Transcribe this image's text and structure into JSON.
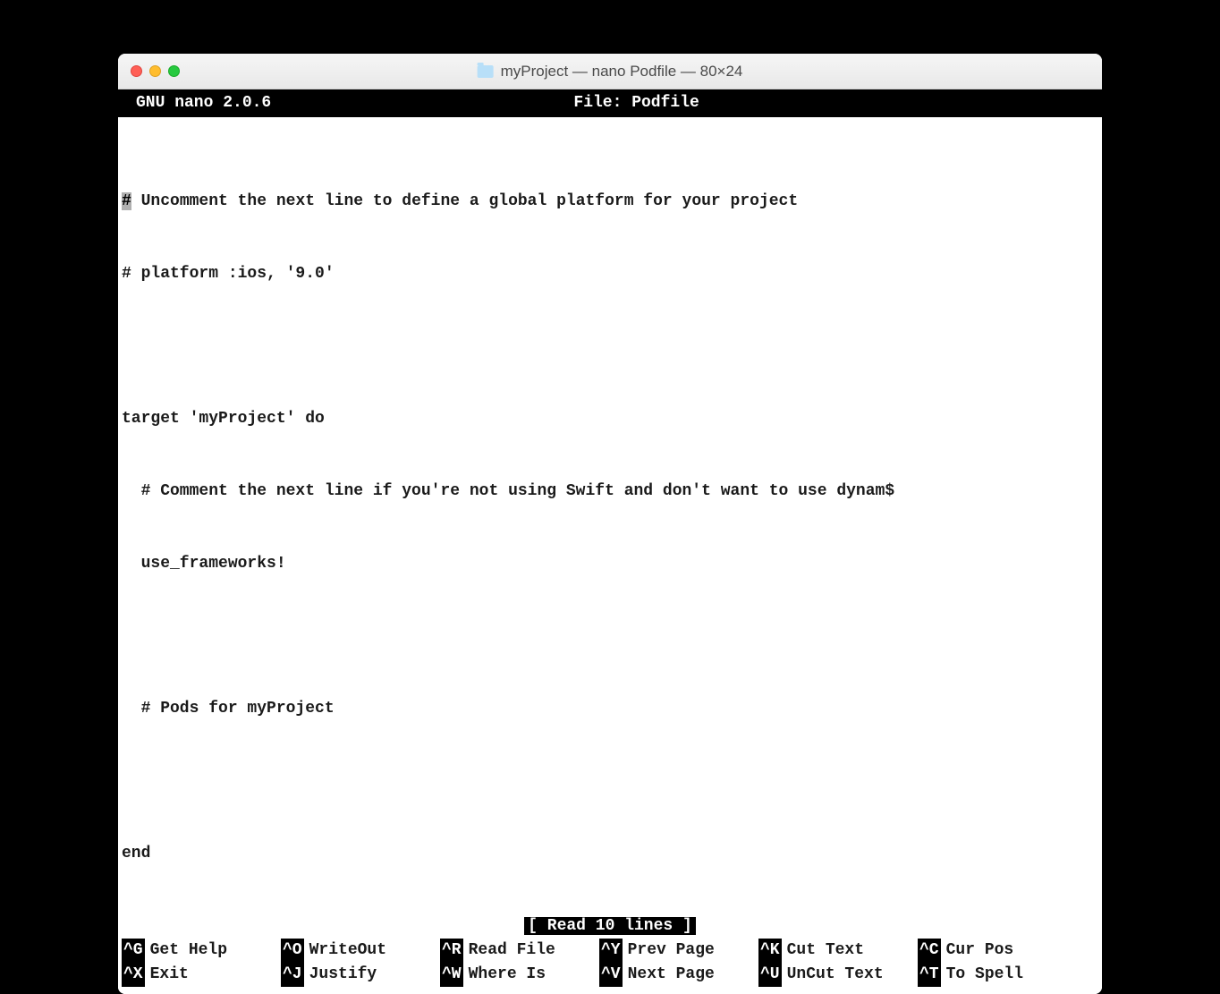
{
  "window": {
    "title": "myProject — nano Podfile — 80×24"
  },
  "header": {
    "app_name": "GNU nano 2.0.6",
    "file_label": "File: Podfile"
  },
  "editor": {
    "lines": [
      {
        "cursor_char": "#",
        "rest": " Uncomment the next line to define a global platform for your project"
      },
      {
        "text": "# platform :ios, '9.0'"
      },
      {
        "text": ""
      },
      {
        "text": "target 'myProject' do"
      },
      {
        "text": "  # Comment the next line if you're not using Swift and don't want to use dynam$"
      },
      {
        "text": "  use_frameworks!"
      },
      {
        "text": ""
      },
      {
        "text": "  # Pods for myProject"
      },
      {
        "text": ""
      },
      {
        "text": "end"
      }
    ]
  },
  "status": {
    "text": "[ Read 10 lines ]"
  },
  "shortcuts": {
    "row1": [
      {
        "key": "^G",
        "label": "Get Help"
      },
      {
        "key": "^O",
        "label": "WriteOut"
      },
      {
        "key": "^R",
        "label": "Read File"
      },
      {
        "key": "^Y",
        "label": "Prev Page"
      },
      {
        "key": "^K",
        "label": "Cut Text"
      },
      {
        "key": "^C",
        "label": "Cur Pos"
      }
    ],
    "row2": [
      {
        "key": "^X",
        "label": "Exit"
      },
      {
        "key": "^J",
        "label": "Justify"
      },
      {
        "key": "^W",
        "label": "Where Is"
      },
      {
        "key": "^V",
        "label": "Next Page"
      },
      {
        "key": "^U",
        "label": "UnCut Text"
      },
      {
        "key": "^T",
        "label": "To Spell"
      }
    ]
  }
}
